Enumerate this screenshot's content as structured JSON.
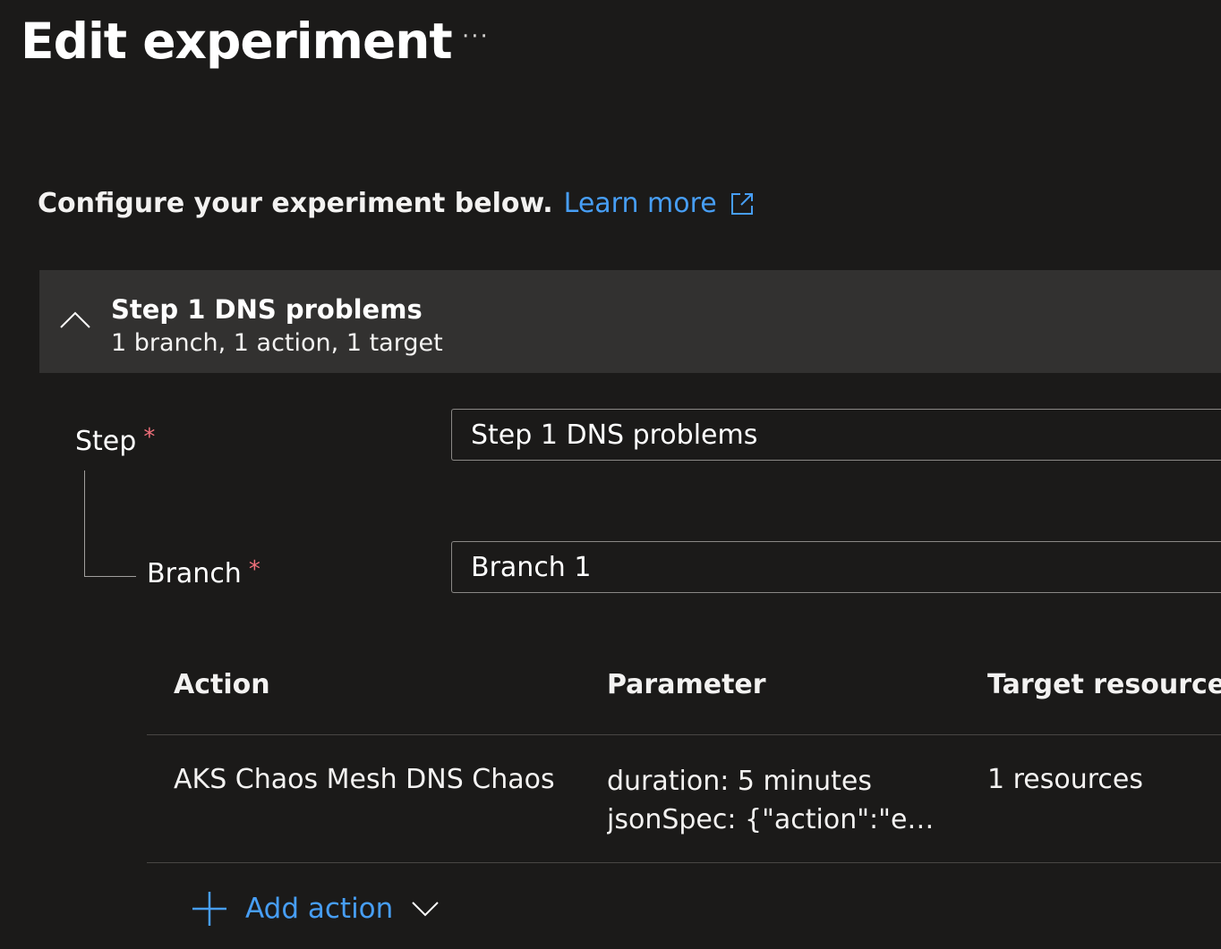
{
  "header": {
    "title": "Edit experiment",
    "more_label": "···"
  },
  "intro": {
    "text": "Configure your experiment below.",
    "learn_more": "Learn more"
  },
  "step": {
    "title": "Step 1 DNS problems",
    "summary": "1 branch, 1 action, 1 target",
    "step_label": "Step",
    "step_value": "Step 1 DNS problems",
    "branch_label": "Branch",
    "branch_value": "Branch 1",
    "required_mark": "*"
  },
  "actions_table": {
    "columns": [
      "Action",
      "Parameter",
      "Target resources"
    ],
    "rows": [
      {
        "action": "AKS Chaos Mesh DNS Chaos",
        "parameters": [
          "duration: 5 minutes",
          "jsonSpec: {\"action\":\"error\"}"
        ],
        "targets": "1 resources"
      }
    ]
  },
  "add_action": {
    "label": "Add action"
  },
  "colors": {
    "background": "#1b1a19",
    "accent": "#479ef5",
    "header_band": "#323130",
    "required": "#f1707b"
  }
}
